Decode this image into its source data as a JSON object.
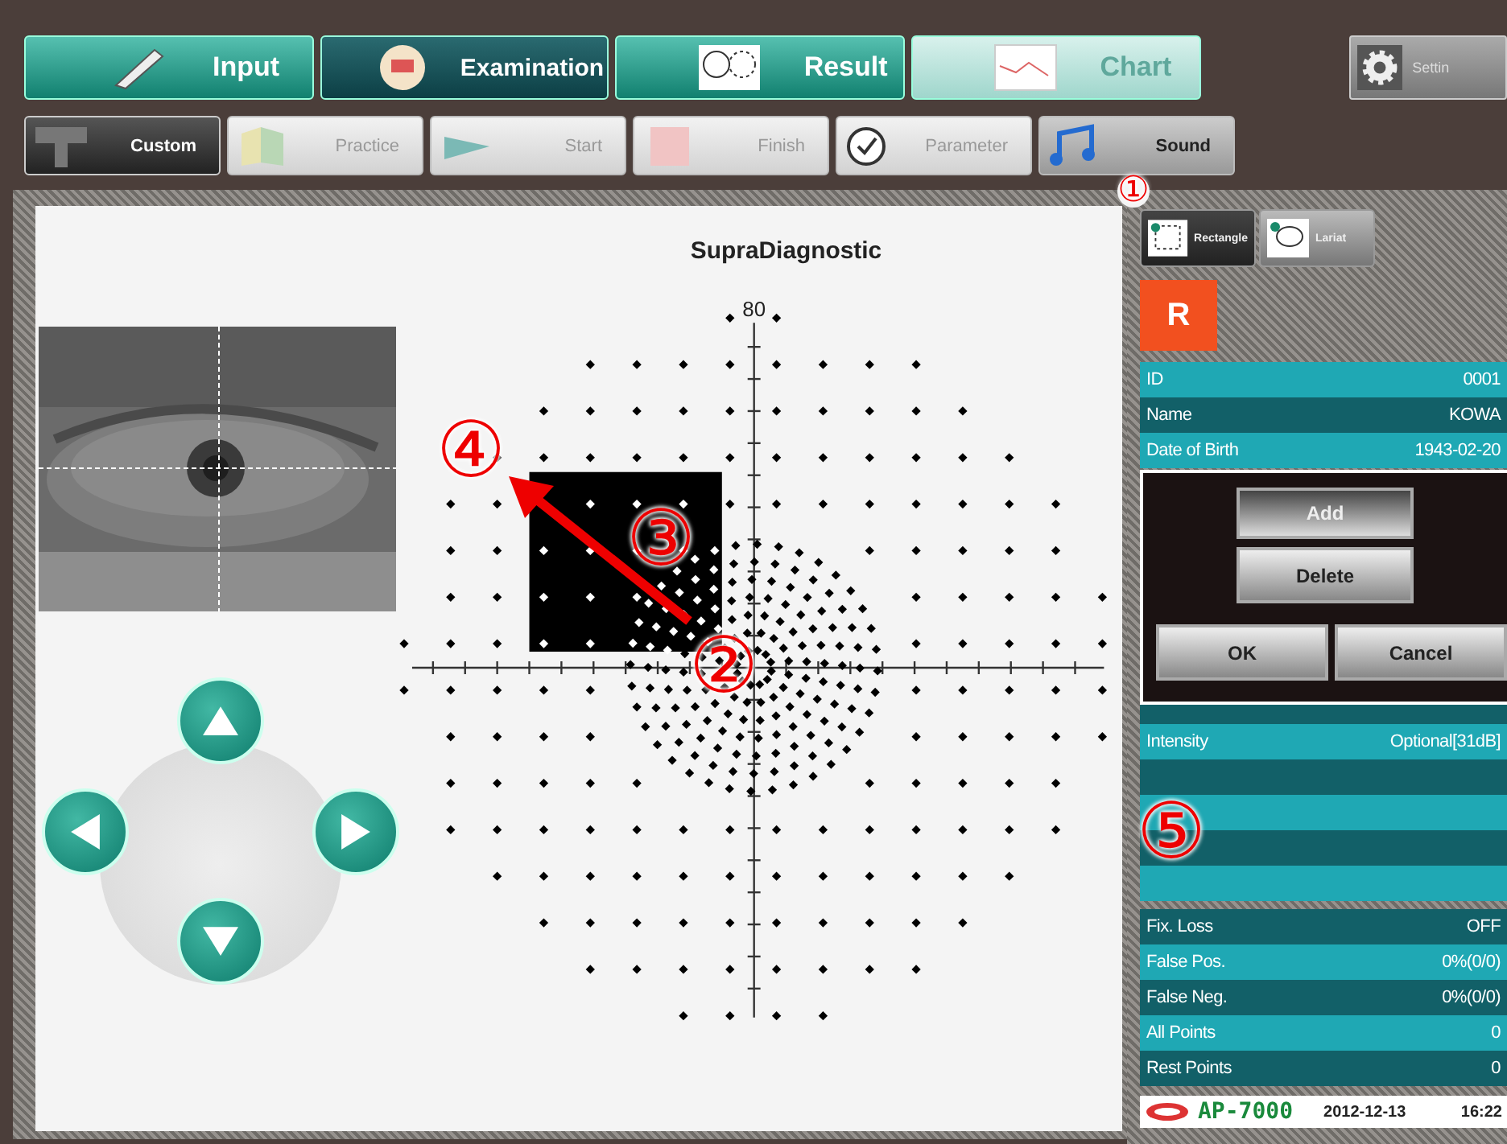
{
  "main_tabs": [
    {
      "label": "Input",
      "selected": false,
      "disabled": false
    },
    {
      "label": "Examination",
      "selected": true,
      "disabled": false
    },
    {
      "label": "Result",
      "selected": false,
      "disabled": false
    },
    {
      "label": "Chart",
      "selected": false,
      "disabled": true
    }
  ],
  "setting_button": {
    "label": "Settin"
  },
  "sub_tabs": [
    {
      "label": "Custom",
      "selected": true,
      "disabled": false
    },
    {
      "label": "Practice",
      "selected": false,
      "disabled": true
    },
    {
      "label": "Start",
      "selected": false,
      "disabled": true
    },
    {
      "label": "Finish",
      "selected": false,
      "disabled": true
    },
    {
      "label": "Parameter",
      "selected": false,
      "disabled": true
    },
    {
      "label": "Sound",
      "selected": false,
      "disabled": false
    }
  ],
  "plot": {
    "title": "SupraDiagnostic",
    "axis_label": "80"
  },
  "tool_buttons": [
    {
      "label": "Rectangle",
      "selected": true
    },
    {
      "label": "Lariat",
      "selected": false
    }
  ],
  "eye_badge": "R",
  "patient_rows": [
    {
      "label": "ID",
      "value": "0001"
    },
    {
      "label": "Name",
      "value": "KOWA"
    },
    {
      "label": "Date of Birth",
      "value": "1943-02-20"
    }
  ],
  "dialog": {
    "buttons": [
      {
        "label": "Add",
        "selected": true
      },
      {
        "label": "Delete",
        "selected": false
      },
      {
        "label": "OK",
        "selected": false
      },
      {
        "label": "Cancel",
        "selected": false
      }
    ]
  },
  "intensity_row": {
    "label": "Intensity",
    "value": "Optional[31dB]"
  },
  "stats_rows": [
    {
      "label": "Fix. Loss",
      "value": "OFF"
    },
    {
      "label": "False Pos.",
      "value": "0%(0/0)"
    },
    {
      "label": "False Neg.",
      "value": "0%(0/0)"
    },
    {
      "label": "All Points",
      "value": "0"
    },
    {
      "label": "Rest Points",
      "value": "0"
    }
  ],
  "footer": {
    "model": "AP-7000",
    "date": "2012-12-13",
    "time": "16:22"
  },
  "annotations": [
    "①",
    "②",
    "③",
    "④",
    "⑤"
  ]
}
